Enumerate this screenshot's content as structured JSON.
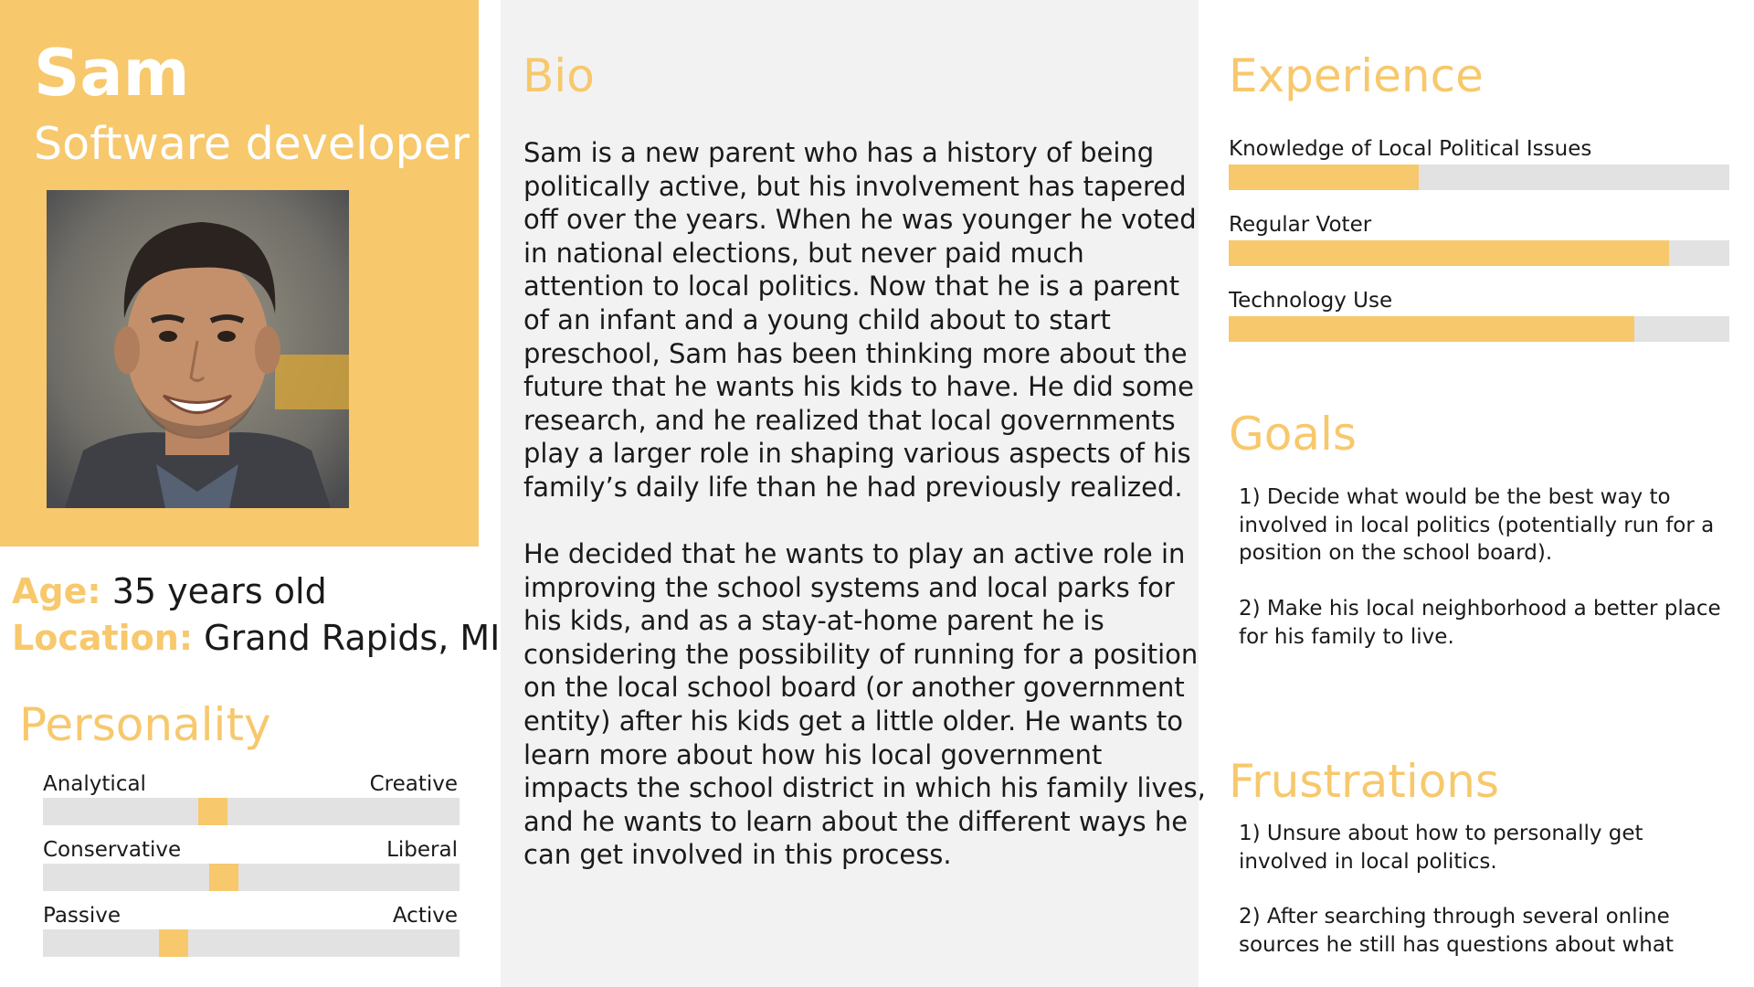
{
  "persona": {
    "name": "Sam",
    "role": "Software developer",
    "portrait_alt": "photo",
    "age_label": "Age:",
    "age_value": "35 years old",
    "location_label": "Location:",
    "location_value": "Grand Rapids, MI"
  },
  "personality": {
    "heading": "Personality",
    "sliders": [
      {
        "left": "Analytical",
        "right": "Creative",
        "position": 0.4
      },
      {
        "left": "Conservative",
        "right": "Liberal",
        "position": 0.43
      },
      {
        "left": "Passive",
        "right": "Active",
        "position": 0.3
      }
    ]
  },
  "bio": {
    "heading": "Bio",
    "paragraphs": [
      "Sam is a new parent who has a history of being politically active, but his involvement has tapered off over the years. When he was younger he voted in national elections, but never paid much attention to local politics. Now that he is a parent of an infant and a young child about to start preschool, Sam has been thinking more about the future that he wants his kids to have. He did some research, and he realized that local governments play a larger role in shaping various aspects of his family’s daily life than he had previously realized.",
      "He decided that he wants to play an active role in improving the school systems and local parks for his kids, and as a stay-at-home parent he is considering the possibility of running for a position on the local school board (or another government entity) after his kids get a little older. He wants to learn more about how his local government impacts the school district in which his family lives, and he wants to learn about the different ways he can get involved in this process."
    ]
  },
  "experience": {
    "heading": "Experience",
    "meters": [
      {
        "label": "Knowledge of Local Political Issues",
        "fill": 0.38
      },
      {
        "label": "Regular Voter",
        "fill": 0.88
      },
      {
        "label": "Technology Use",
        "fill": 0.81
      }
    ]
  },
  "goals": {
    "heading": "Goals",
    "items": [
      "1) Decide what would be the best way to involved in local politics (potentially run for a position on the school board).",
      "2) Make his local neighborhood a better place for his family to live."
    ]
  },
  "frustrations": {
    "heading": "Frustrations",
    "items": [
      "1) Unsure about how to personally get involved in local politics.",
      "2) After searching through several online sources he still has questions about what"
    ]
  },
  "colors": {
    "accent": "#f7c86c",
    "track": "#e2e2e2",
    "bio_panel": "#f2f2f2",
    "text": "#1a1a1a"
  }
}
